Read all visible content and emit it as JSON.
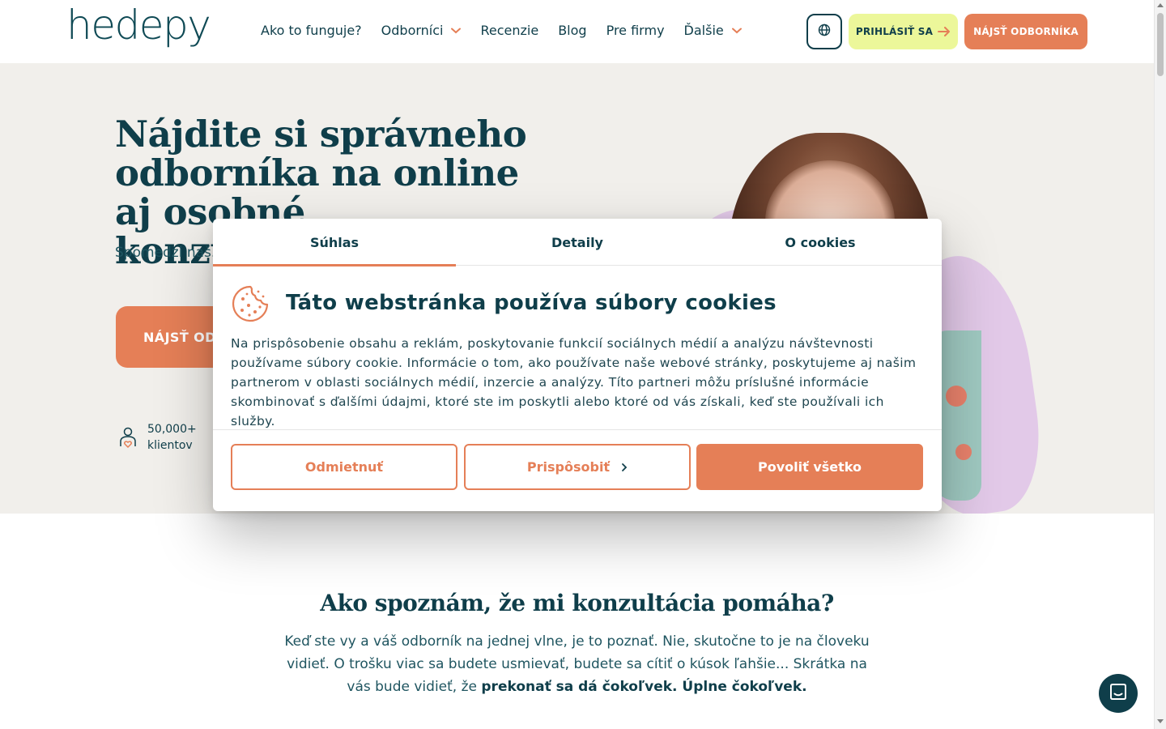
{
  "header": {
    "logo": "hedepy",
    "nav": [
      {
        "label": "Ako to funguje?",
        "dropdown": false
      },
      {
        "label": "Odborníci",
        "dropdown": true
      },
      {
        "label": "Recenzie",
        "dropdown": false
      },
      {
        "label": "Blog",
        "dropdown": false
      },
      {
        "label": "Pre firmy",
        "dropdown": false
      },
      {
        "label": "Ďalšie",
        "dropdown": true
      }
    ],
    "login_label": "PRIHLÁSIŤ SA",
    "find_label": "NÁJSŤ ODBORNÍKA"
  },
  "hero": {
    "title": "Nájdite si správneho odborníka na online aj osobné konzultácie",
    "subtitle": "Spomedzi naš... vám pomôžem...",
    "cta_label": "NÁJSŤ ODB...",
    "stat_value": "50,000+",
    "stat_label": "klientov"
  },
  "section": {
    "title": "Ako spoznám, že mi konzultácia pomáha?",
    "text_plain": "Keď ste vy a váš odborník na jednej vlne, je to poznať. Nie, skutočne to je na človeku vidieť. O trošku viac sa budete usmievať, budete sa cítiť o kúsok ľahšie... Skrátka na vás bude vidieť, že ",
    "text_bold": "prekonať sa dá čokoľvek. Úplne čokoľvek."
  },
  "cookie_modal": {
    "tabs": [
      "Súhlas",
      "Detaily",
      "O cookies"
    ],
    "active_tab": "Súhlas",
    "title": "Táto webstránka používa súbory cookies",
    "body": "Na prispôsobenie obsahu a reklám, poskytovanie funkcií sociálnych médií a analýzu návštevnosti používame súbory cookie. Informácie o tom, ako používate naše webové stránky, poskytujeme aj našim partnerom v oblasti sociálnych médií, inzercie a analýzy. Títo partneri môžu príslušné informácie skombinovať s ďalšími údajmi, ktoré ste im poskytli alebo ktoré od vás získali, keď ste používali ich služby.",
    "deny_label": "Odmietnuť",
    "customize_label": "Prispôsobiť",
    "allow_label": "Povoliť všetko"
  },
  "colors": {
    "primary": "#0f3e4a",
    "accent": "#e57f57",
    "login_bg": "#ecf79a",
    "hero_bg": "#f1efeb",
    "blob": "#e2c9e8"
  },
  "icons": [
    "globe-icon",
    "arrow-right-icon",
    "chevron-down-icon",
    "user-heart-icon",
    "cookie-icon",
    "chevron-right-icon",
    "chat-icon"
  ]
}
